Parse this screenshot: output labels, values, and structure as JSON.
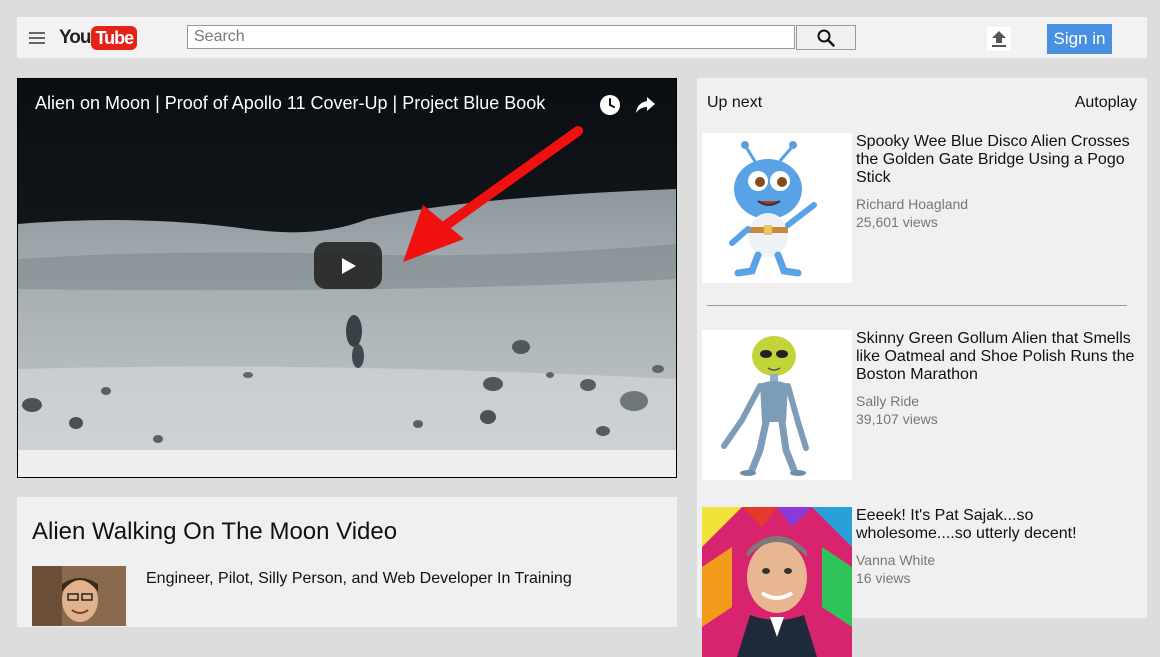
{
  "header": {
    "logo_you": "You",
    "logo_tube": "Tube",
    "search_placeholder": "Search",
    "signin_label": "Sign in"
  },
  "player": {
    "title": "Alien on Moon | Proof of Apollo 11 Cover-Up | Project Blue Book"
  },
  "video": {
    "title": "Alien Walking On The Moon Video",
    "uploader_description": "Engineer, Pilot, Silly Person, and Web Developer In Training"
  },
  "sidebar": {
    "up_next": "Up next",
    "autoplay": "Autoplay",
    "items": [
      {
        "title": "Spooky Wee Blue Disco Alien Crosses the Golden Gate Bridge Using a Pogo Stick",
        "channel": "Richard Hoagland",
        "views": "25,601 views"
      },
      {
        "title": "Skinny Green Gollum Alien that Smells like Oatmeal and Shoe Polish Runs the Boston Marathon",
        "channel": "Sally Ride",
        "views": "39,107 views"
      },
      {
        "title": "Eeeek! It's Pat Sajak...so wholesome....so utterly decent!",
        "channel": "Vanna White",
        "views": "16 views"
      }
    ]
  },
  "colors": {
    "brand_red": "#e62117",
    "signin_blue": "#4a90e2",
    "arrow_red": "#f01010"
  }
}
